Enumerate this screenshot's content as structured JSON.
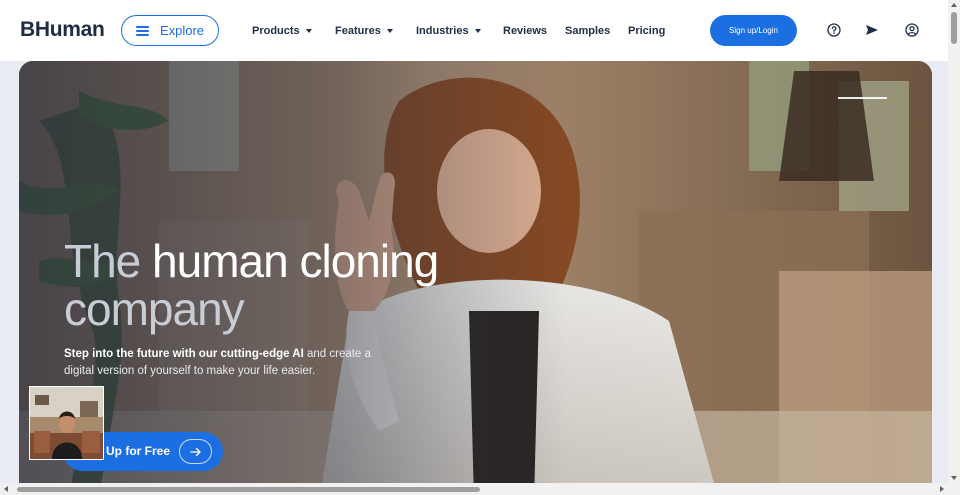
{
  "header": {
    "logo": "BHuman",
    "explore_label": "Explore",
    "nav": [
      {
        "label": "Products",
        "has_dropdown": true
      },
      {
        "label": "Features",
        "has_dropdown": true
      },
      {
        "label": "Industries",
        "has_dropdown": true
      },
      {
        "label": "Reviews",
        "has_dropdown": false
      },
      {
        "label": "Samples",
        "has_dropdown": false
      },
      {
        "label": "Pricing",
        "has_dropdown": false
      }
    ],
    "signup_label": "Sign up/Login",
    "icons": [
      "help-circle-icon",
      "send-icon",
      "user-circle-icon"
    ]
  },
  "hero": {
    "title_light": "The ",
    "title_strong": "human cloning",
    "title_line2": "company",
    "subtitle_highlight": "Step into the future with our cutting-edge AI",
    "subtitle_rest": " and create a digital version of yourself to make your life easier.",
    "cta_label": "Up for Free"
  },
  "colors": {
    "accent": "#1c6fe3",
    "logo_text": "#1d2b44",
    "nav_text": "#1f2d45"
  }
}
